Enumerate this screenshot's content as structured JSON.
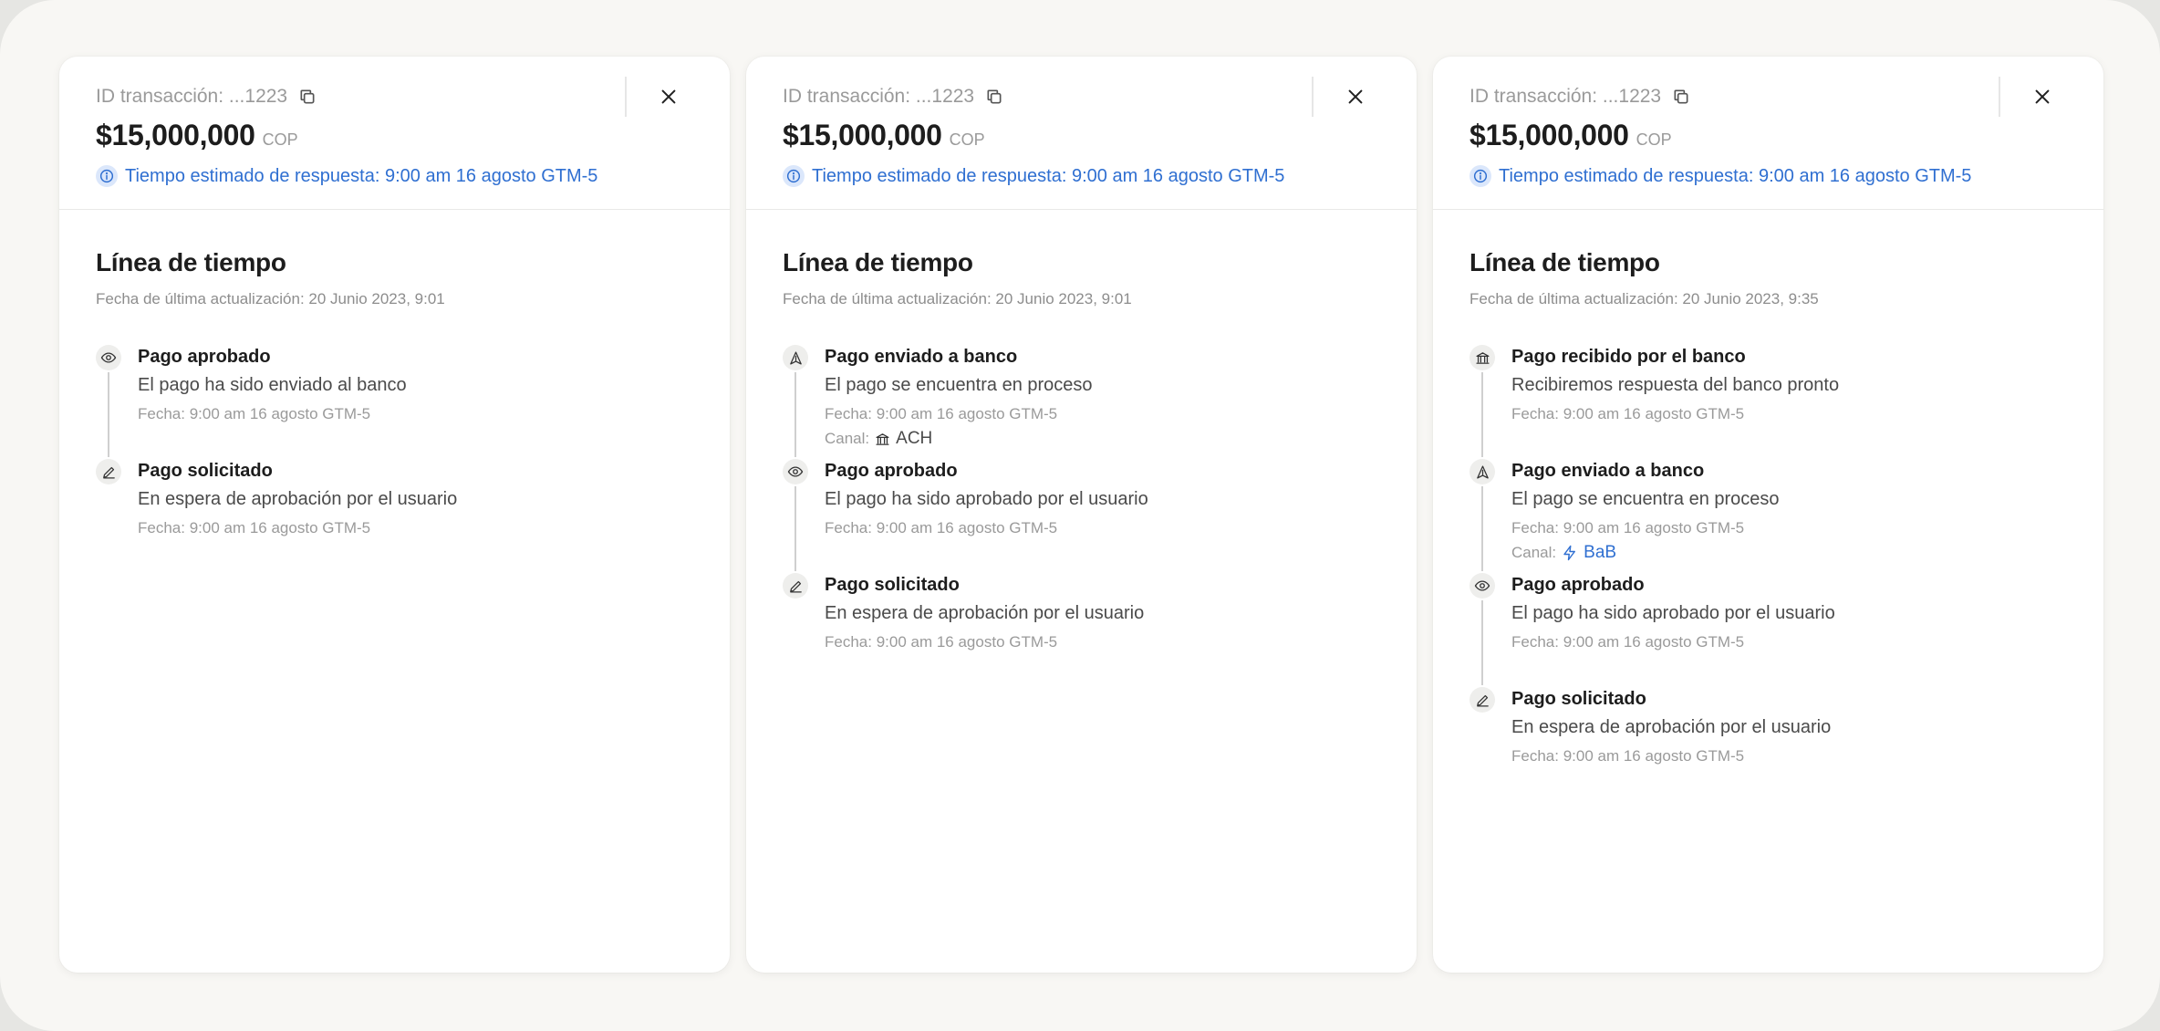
{
  "panels": [
    {
      "tx_label": "ID transacción: ...1223",
      "amount": "$15,000,000",
      "currency": "COP",
      "eta": "Tiempo estimado de respuesta: 9:00 am 16 agosto GTM-5",
      "timeline_title": "Línea de tiempo",
      "updated": "Fecha de última actualización: 20 Junio 2023, 9:01",
      "events": [
        {
          "icon": "eye-icon",
          "title": "Pago aprobado",
          "desc": "El pago ha sido enviado al banco",
          "date": "Fecha: 9:00 am 16 agosto GTM-5"
        },
        {
          "icon": "pen-icon",
          "title": "Pago solicitado",
          "desc": "En espera de aprobación por el usuario",
          "date": "Fecha: 9:00 am 16 agosto GTM-5"
        }
      ]
    },
    {
      "tx_label": "ID transacción: ...1223",
      "amount": "$15,000,000",
      "currency": "COP",
      "eta": "Tiempo estimado de respuesta: 9:00 am 16 agosto GTM-5",
      "timeline_title": "Línea de tiempo",
      "updated": "Fecha de última actualización: 20 Junio 2023, 9:01",
      "events": [
        {
          "icon": "send-icon",
          "title": "Pago enviado a banco",
          "desc": "El pago se encuentra en proceso",
          "date": "Fecha: 9:00 am 16 agosto GTM-5",
          "channel_label": "Canal:",
          "channel_icon": "bank-icon",
          "channel_name": "ACH"
        },
        {
          "icon": "eye-icon",
          "title": "Pago aprobado",
          "desc": "El pago ha sido aprobado por el usuario",
          "date": "Fecha: 9:00 am 16 agosto GTM-5"
        },
        {
          "icon": "pen-icon",
          "title": "Pago solicitado",
          "desc": "En espera de aprobación por el usuario",
          "date": "Fecha: 9:00 am 16 agosto GTM-5"
        }
      ]
    },
    {
      "tx_label": "ID transacción: ...1223",
      "amount": "$15,000,000",
      "currency": "COP",
      "eta": "Tiempo estimado de respuesta: 9:00 am 16 agosto GTM-5",
      "timeline_title": "Línea de tiempo",
      "updated": "Fecha de última actualización: 20 Junio 2023, 9:35",
      "events": [
        {
          "icon": "bank-icon",
          "title": "Pago recibido por el banco",
          "desc": "Recibiremos respuesta del banco pronto",
          "date": "Fecha: 9:00 am 16 agosto GTM-5"
        },
        {
          "icon": "send-icon",
          "title": "Pago enviado a banco",
          "desc": "El pago se encuentra en proceso",
          "date": "Fecha: 9:00 am 16 agosto GTM-5",
          "channel_label": "Canal:",
          "channel_icon": "lightning-icon",
          "channel_name": "BaB"
        },
        {
          "icon": "eye-icon",
          "title": "Pago aprobado",
          "desc": "El pago ha sido aprobado por el usuario",
          "date": "Fecha: 9:00 am 16 agosto GTM-5"
        },
        {
          "icon": "pen-icon",
          "title": "Pago solicitado",
          "desc": "En espera de aprobación por el usuario",
          "date": "Fecha: 9:00 am 16 agosto GTM-5"
        }
      ]
    }
  ],
  "colors": {
    "accent": "#2f6fd1",
    "muted": "#9a9a9a",
    "background": "#f8f7f4"
  }
}
